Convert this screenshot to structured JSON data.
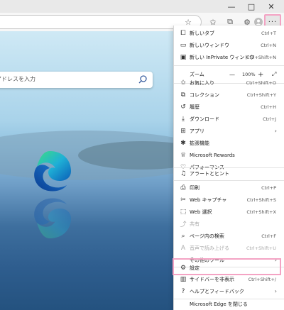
{
  "window": {
    "minimize_symbol": "—",
    "maximize_symbol": "□",
    "close_symbol": "✕"
  },
  "toolbar": {
    "more_label": "···"
  },
  "search": {
    "placeholder": "アドレスを入力"
  },
  "menu": {
    "new_tab": {
      "label": "新しいタブ",
      "shortcut": "Ctrl+T"
    },
    "new_window": {
      "label": "新しいウィンドウ",
      "shortcut": "Ctrl+N"
    },
    "new_inprivate": {
      "label": "新しい InPrivate ウィンドウ",
      "shortcut": "Ctrl+Shift+N"
    },
    "zoom": {
      "label": "ズーム",
      "value": "100%",
      "minus": "—",
      "plus": "+"
    },
    "favorites": {
      "label": "お気に入り",
      "shortcut": "Ctrl+Shift+O"
    },
    "collections": {
      "label": "コレクション",
      "shortcut": "Ctrl+Shift+Y"
    },
    "history": {
      "label": "履歴",
      "shortcut": "Ctrl+H"
    },
    "downloads": {
      "label": "ダウンロード",
      "shortcut": "Ctrl+J"
    },
    "apps": {
      "label": "アプリ"
    },
    "extensions": {
      "label": "拡張機能"
    },
    "rewards": {
      "label": "Microsoft Rewards"
    },
    "performance": {
      "label": "パフォーマンス"
    },
    "alerts": {
      "label": "アラートとヒント"
    },
    "print": {
      "label": "印刷",
      "shortcut": "Ctrl+P"
    },
    "web_capture": {
      "label": "Web キャプチャ",
      "shortcut": "Ctrl+Shift+S"
    },
    "web_select": {
      "label": "Web 選択",
      "shortcut": "Ctrl+Shift+X"
    },
    "share": {
      "label": "共有"
    },
    "find": {
      "label": "ページ内の検索",
      "shortcut": "Ctrl+F"
    },
    "read_aloud": {
      "label": "音声で読み上げる",
      "shortcut": "Ctrl+Shift+U"
    },
    "more_tools": {
      "label": "その他のツール"
    },
    "settings": {
      "label": "設定"
    },
    "sidebar": {
      "label": "サイドバーを非表示",
      "shortcut": "Ctrl+Shift+/"
    },
    "help": {
      "label": "ヘルプとフィードバック"
    },
    "close_edge": {
      "label": "Microsoft Edge を閉じる"
    }
  }
}
